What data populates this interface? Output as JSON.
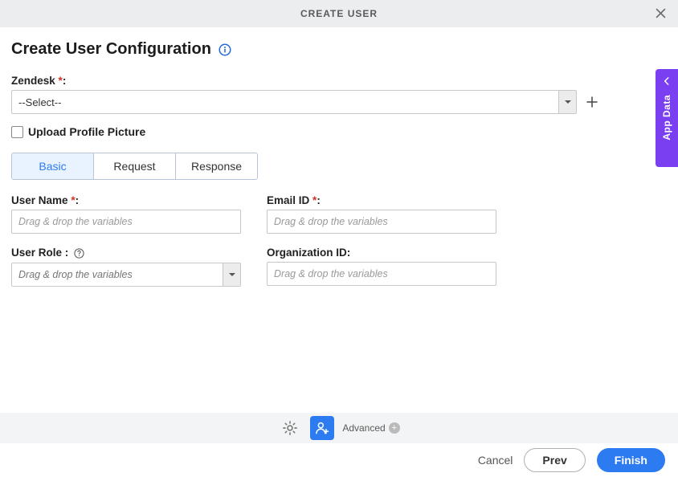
{
  "header": {
    "title": "CREATE USER"
  },
  "page": {
    "title": "Create User Configuration"
  },
  "sidepanel": {
    "label": "App Data"
  },
  "zendesk": {
    "label": "Zendesk",
    "value": "--Select--"
  },
  "upload": {
    "label": "Upload Profile Picture"
  },
  "tabs": {
    "basic": "Basic",
    "request": "Request",
    "response": "Response"
  },
  "fields": {
    "username": {
      "label": "User Name",
      "placeholder": "Drag & drop the variables"
    },
    "email": {
      "label": "Email ID",
      "placeholder": "Drag & drop the variables"
    },
    "userrole": {
      "label": "User Role :",
      "placeholder": "Drag & drop the variables"
    },
    "orgid": {
      "label": "Organization ID:",
      "placeholder": "Drag & drop the variables"
    }
  },
  "toolbar": {
    "advanced": "Advanced"
  },
  "footer": {
    "cancel": "Cancel",
    "prev": "Prev",
    "finish": "Finish"
  }
}
